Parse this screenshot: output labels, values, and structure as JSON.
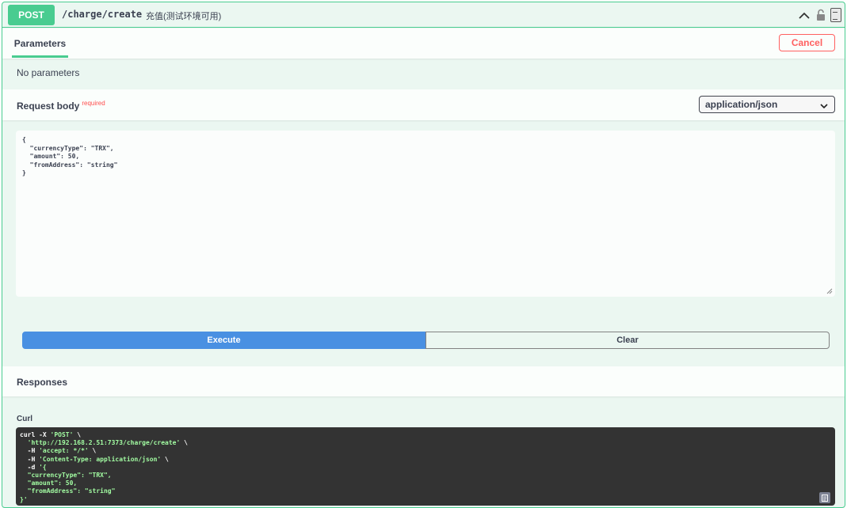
{
  "summary": {
    "method": "POST",
    "path": "/charge/create",
    "description": "充值(测试环境可用)"
  },
  "parameters": {
    "tab_label": "Parameters",
    "cancel_label": "Cancel",
    "empty_text": "No parameters"
  },
  "request_body": {
    "title": "Request body",
    "required_label": "required",
    "content_type": "application/json",
    "body_lines": [
      "{",
      "  \"currencyType\": \"TRX\",",
      "  \"amount\": 50,",
      "  \"fromAddress\": \"string\"",
      "}"
    ]
  },
  "actions": {
    "execute_label": "Execute",
    "clear_label": "Clear"
  },
  "responses": {
    "title": "Responses",
    "curl_label": "Curl",
    "curl_lines": [
      {
        "plain": "curl -X ",
        "str": "'POST'",
        "tail": " \\"
      },
      {
        "plain": "  ",
        "str": "'http://192.168.2.51:7373/charge/create'",
        "tail": " \\"
      },
      {
        "plain": "  -H ",
        "str": "'accept: */*'",
        "tail": " \\"
      },
      {
        "plain": "  -H ",
        "str": "'Content-Type: application/json'",
        "tail": " \\"
      },
      {
        "plain": "  -d ",
        "str": "'{",
        "tail": ""
      },
      {
        "plain": "",
        "str": "  \"currencyType\": \"TRX\",",
        "tail": ""
      },
      {
        "plain": "",
        "str": "  \"amount\": 50,",
        "tail": ""
      },
      {
        "plain": "",
        "str": "  \"fromAddress\": \"string\"",
        "tail": ""
      },
      {
        "plain": "",
        "str": "}'",
        "tail": ""
      }
    ]
  },
  "icons": {
    "collapse": "chevron-up-icon",
    "lock": "lock-icon",
    "copy": "copy-icon"
  },
  "colors": {
    "post_green": "#49cc90",
    "block_bg": "#ebf7f1",
    "execute_blue": "#4990e2",
    "cancel_red": "#ff6060",
    "curl_bg": "#333333"
  }
}
